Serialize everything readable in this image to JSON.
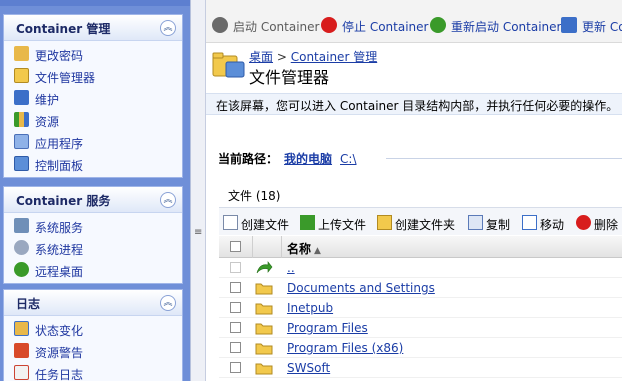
{
  "sidebar": {
    "panels": [
      {
        "title": "Container 管理",
        "items": [
          {
            "label": "更改密码",
            "icon": "key-icon"
          },
          {
            "label": "文件管理器",
            "icon": "file-manager-icon"
          },
          {
            "label": "维护",
            "icon": "maintenance-icon"
          },
          {
            "label": "资源",
            "icon": "resources-icon"
          },
          {
            "label": "应用程序",
            "icon": "applications-icon"
          },
          {
            "label": "控制面板",
            "icon": "control-panel-icon"
          }
        ]
      },
      {
        "title": "Container 服务",
        "items": [
          {
            "label": "系统服务",
            "icon": "system-services-icon"
          },
          {
            "label": "系统进程",
            "icon": "system-processes-icon"
          },
          {
            "label": "远程桌面",
            "icon": "remote-desktop-icon"
          }
        ]
      },
      {
        "title": "日志",
        "items": [
          {
            "label": "状态变化",
            "icon": "status-change-icon"
          },
          {
            "label": "资源警告",
            "icon": "resource-alert-icon"
          },
          {
            "label": "任务日志",
            "icon": "task-log-icon"
          }
        ]
      }
    ]
  },
  "toolbar": {
    "start": "启动 Container",
    "stop": "停止 Container",
    "restart": "重新启动 Container",
    "update": "更新 Co"
  },
  "breadcrumb": {
    "desktop": "桌面",
    "separator": ">",
    "container": "Container 管理"
  },
  "page_title": "文件管理器",
  "info_text": "在该屏幕，您可以进入 Container 目录结构内部，并执行任何必要的操作。",
  "path": {
    "label": "当前路径：",
    "computer": "我的电脑",
    "drive": "C:\\"
  },
  "file_count": "文件 (18)",
  "file_actions": {
    "create_file": "创建文件",
    "upload_file": "上传文件",
    "create_folder": "创建文件夹",
    "copy": "复制",
    "move": "移动",
    "delete": "删除"
  },
  "table": {
    "name_header": "名称",
    "sort_indicator": "▲",
    "rows": [
      {
        "name": "..",
        "icon": "parent-folder-icon"
      },
      {
        "name": "Documents and Settings",
        "icon": "folder-icon"
      },
      {
        "name": "Inetpub",
        "icon": "folder-icon"
      },
      {
        "name": "Program Files",
        "icon": "folder-icon"
      },
      {
        "name": "Program Files (x86)",
        "icon": "folder-icon"
      },
      {
        "name": "SWSoft",
        "icon": "folder-icon"
      }
    ]
  },
  "colors": {
    "sidebar_bg": "#6f8fd8",
    "link": "#1b3da6",
    "stop_red": "#d81d1d",
    "start_gray": "#6a6a6a",
    "green": "#3a9a2a",
    "folder_yellow": "#f2c94c"
  }
}
